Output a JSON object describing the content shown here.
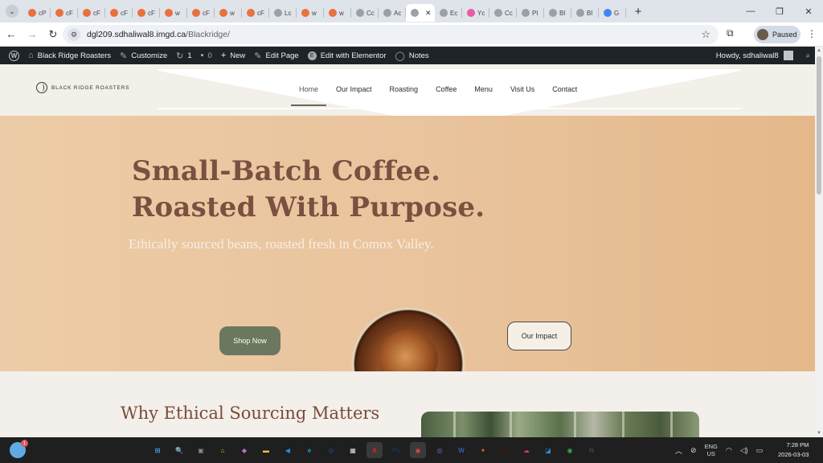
{
  "browser": {
    "tabs": [
      {
        "label": "cP",
        "color": "#e8713c"
      },
      {
        "label": "cF",
        "color": "#e8713c"
      },
      {
        "label": "cF",
        "color": "#e8713c"
      },
      {
        "label": "cF",
        "color": "#e8713c"
      },
      {
        "label": "cF",
        "color": "#e8713c"
      },
      {
        "label": "w",
        "color": "#e8713c"
      },
      {
        "label": "cF",
        "color": "#e8713c"
      },
      {
        "label": "w",
        "color": "#e8713c"
      },
      {
        "label": "cF",
        "color": "#e8713c"
      },
      {
        "label": "Lc",
        "color": "#9aa0a6"
      },
      {
        "label": "w",
        "color": "#e8713c"
      },
      {
        "label": "w",
        "color": "#e8713c"
      },
      {
        "label": "Cc",
        "color": "#9aa0a6"
      },
      {
        "label": "Ac",
        "color": "#9aa0a6"
      },
      {
        "label": "",
        "color": "#9aa0a6",
        "active": true
      },
      {
        "label": "Ec",
        "color": "#9aa0a6"
      },
      {
        "label": "Yc",
        "color": "#e95aa5"
      },
      {
        "label": "Cc",
        "color": "#9aa0a6"
      },
      {
        "label": "Pl",
        "color": "#9aa0a6"
      },
      {
        "label": "Bl",
        "color": "#9aa0a6"
      },
      {
        "label": "Bl",
        "color": "#9aa0a6"
      },
      {
        "label": "G",
        "color": "#4285f4"
      }
    ],
    "url_host": "dgl209.sdhaliwal8.imgd.ca",
    "url_path": "/Blackridge/",
    "profile_label": "Paused",
    "new_tab_symbol": "+",
    "tab_close_symbol": "✕"
  },
  "adminbar": {
    "site_name": "Black Ridge Roasters",
    "customize": "Customize",
    "updates_count": "1",
    "comments_count": "0",
    "new_label": "New",
    "edit_page": "Edit Page",
    "elementor": "Edit with Elementor",
    "notes": "Notes",
    "howdy": "Howdy, sdhaliwal8"
  },
  "site": {
    "logo_text": "BLACK RIDGE ROASTERS",
    "nav": [
      "Home",
      "Our Impact",
      "Roasting",
      "Coffee",
      "Menu",
      "Visit Us",
      "Contact"
    ],
    "hero_title_line1": "Small-Batch Coffee.",
    "hero_title_line2": "Roasted With Purpose.",
    "hero_subtitle": "Ethically sourced beans, roasted fresh in Comox Valley.",
    "btn_shop": "Shop Now",
    "btn_impact": "Our Impact",
    "section_title": "Why Ethical Sourcing Matters"
  },
  "taskbar": {
    "weather_badge": "1",
    "lang_line1": "ENG",
    "lang_line2": "US",
    "time": "7:28 PM",
    "date": "2026-03-03",
    "apps": [
      {
        "name": "windows-start-icon",
        "label": "⊞",
        "color": "#4aa8ff"
      },
      {
        "name": "search-icon",
        "label": "🔍",
        "color": "#3a9fe0"
      },
      {
        "name": "task-view-icon",
        "label": "▣",
        "color": "#888"
      },
      {
        "name": "home-icon",
        "label": "⌂",
        "color": "#e2b233"
      },
      {
        "name": "copilot-icon",
        "label": "◆",
        "color": "#c86ad9"
      },
      {
        "name": "file-explorer-icon",
        "label": "▬",
        "color": "#f0c040"
      },
      {
        "name": "vscode-icon",
        "label": "◀",
        "color": "#2a8ad8"
      },
      {
        "name": "edge-icon",
        "label": "e",
        "color": "#1aa0c8"
      },
      {
        "name": "dropbox-icon",
        "label": "◇",
        "color": "#1a70e0"
      },
      {
        "name": "store-icon",
        "label": "▦",
        "color": "#ddd"
      },
      {
        "name": "acrobat-icon",
        "label": "A",
        "color": "#e02020",
        "active": true
      },
      {
        "name": "photoshop-icon",
        "label": "Ps",
        "color": "#1b3352"
      },
      {
        "name": "chrome-icon",
        "label": "◉",
        "color": "#d84a3a",
        "active": true
      },
      {
        "name": "github-icon",
        "label": "◎",
        "color": "#8a5ad8"
      },
      {
        "name": "word-icon",
        "label": "W",
        "color": "#2b5fb8"
      },
      {
        "name": "figma-icon",
        "label": "✦",
        "color": "#e05a3a"
      },
      {
        "name": "illustrator-icon",
        "label": "Ai",
        "color": "#3a1a08"
      },
      {
        "name": "creative-cloud-icon",
        "label": "☁",
        "color": "#e03a5a"
      },
      {
        "name": "photos-icon",
        "label": "◪",
        "color": "#2a8ad8"
      },
      {
        "name": "chrome-alt-icon",
        "label": "◉",
        "color": "#3aa84a"
      },
      {
        "name": "notion-icon",
        "label": "N",
        "color": "#444"
      }
    ]
  }
}
